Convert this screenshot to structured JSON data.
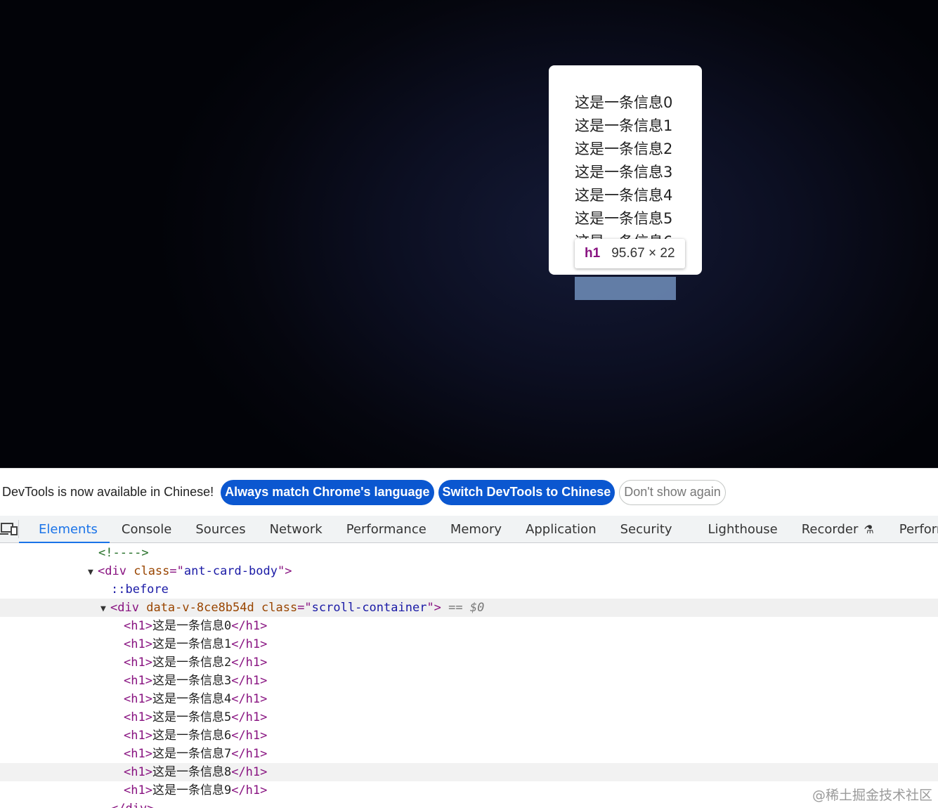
{
  "viewport": {
    "messages": [
      "这是一条信息0",
      "这是一条信息1",
      "这是一条信息2",
      "这是一条信息3",
      "这是一条信息4",
      "这是一条信息5",
      "这是一条信息6"
    ],
    "tooltip": {
      "tag": "h1",
      "dims": "95.67 × 22"
    }
  },
  "banner": {
    "text": "DevTools is now available in Chinese!",
    "btn_match": "Always match Chrome's language",
    "btn_switch": "Switch DevTools to Chinese",
    "btn_dismiss": "Don't show again"
  },
  "tabs": [
    "Elements",
    "Console",
    "Sources",
    "Network",
    "Performance",
    "Memory",
    "Application",
    "Security",
    "Lighthouse",
    "Recorder",
    "Performance"
  ],
  "tree": {
    "comment": "<!---->",
    "card_body": {
      "tag": "div",
      "attr": "class",
      "value": "ant-card-body"
    },
    "pseudo": "::before",
    "scroll": {
      "tag": "div",
      "attr1": "data-v-8ce8b54d",
      "attr2": "class",
      "value": "scroll-container",
      "eq": "==",
      "ref": "$0"
    },
    "items": [
      "这是一条信息0",
      "这是一条信息1",
      "这是一条信息2",
      "这是一条信息3",
      "这是一条信息4",
      "这是一条信息5",
      "这是一条信息6",
      "这是一条信息7",
      "这是一条信息8",
      "这是一条信息9"
    ],
    "closing": "</div>"
  },
  "watermark": "@稀土掘金技术社区",
  "colors": {
    "accent": "#1a73e8",
    "pill": "#0b57d0",
    "tag": "#881280",
    "attr": "#994500",
    "value": "#1a1aa6"
  }
}
